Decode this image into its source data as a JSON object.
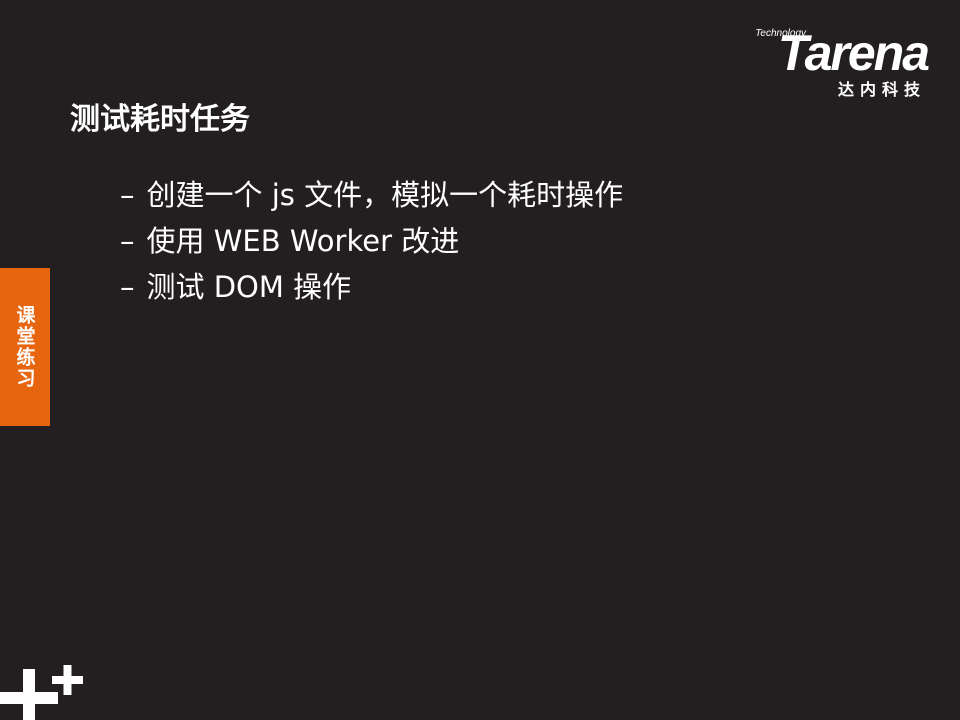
{
  "logo": {
    "technology": "Technology",
    "wordmark": "Tarena",
    "chinese": "达内科技"
  },
  "slide": {
    "title": "测试耗时任务",
    "bullets": [
      "创建一个 js 文件，模拟一个耗时操作",
      "使用 WEB Worker 改进",
      "测试 DOM 操作"
    ],
    "bullet_marker": "–",
    "side_tab": "课堂练习"
  },
  "colors": {
    "background": "#231f20",
    "accent": "#e8650f",
    "text": "#ffffff"
  },
  "icons": {
    "decor": "plus-decor-icon"
  }
}
